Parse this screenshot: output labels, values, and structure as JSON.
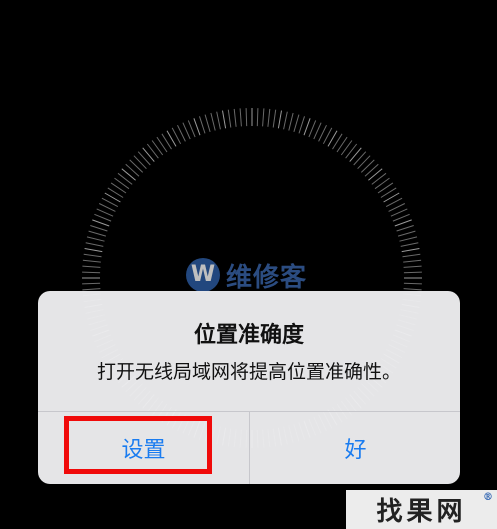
{
  "background": {
    "color": "#000000"
  },
  "watermark": {
    "logo_letter": "W",
    "text": "维修客"
  },
  "alert": {
    "title": "位置准确度",
    "message": "打开无线局域网将提高位置准确性。",
    "buttons": {
      "settings_label": "设置",
      "ok_label": "好"
    },
    "button_color": "#1a7cf0"
  },
  "highlight": {
    "color": "#f00a0a"
  },
  "corner_watermark": {
    "text": "找果网",
    "mark": "®"
  }
}
